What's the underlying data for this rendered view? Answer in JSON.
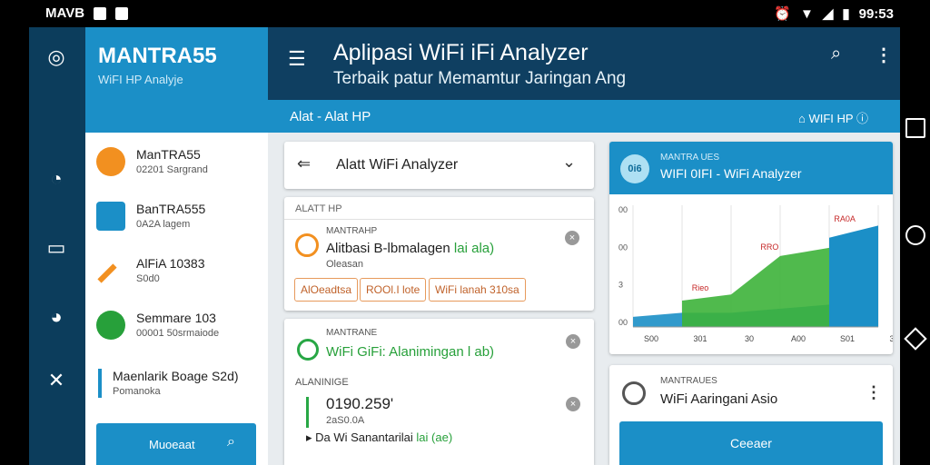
{
  "statusbar": {
    "left_text": "MAVB",
    "time": "99:53"
  },
  "drawer": {
    "title": "MANTRA55",
    "subtitle": "WiFI HP Analyje",
    "items": [
      {
        "t1": "ManTRA55",
        "t2": "02201 Sargrand",
        "color": "#f29020"
      },
      {
        "t1": "BanTRA555",
        "t2": "0A2A lagem",
        "color": "#1b8fc7"
      },
      {
        "t1": "AlFiA 10383",
        "t2": "S0d0",
        "color": "#f29020"
      },
      {
        "t1": "Semmare 103",
        "t2": "00001 50srmaiode",
        "color": "#27a03a"
      },
      {
        "t1": "Maenlarik Boage S2d)",
        "t2": "Pomanoka",
        "color": "#1b8fc7"
      }
    ],
    "button": "Muoeaat"
  },
  "appbar": {
    "title": "Aplipasi WiFi iFi Analyzer",
    "subtitle": "Terbaik patur Memamtur Jaringan Ang"
  },
  "subbar": {
    "left": "Alat - Alat HP",
    "right": "WIFI HP"
  },
  "select": {
    "label": "Alatt WiFi Analyzer"
  },
  "card1": {
    "header": "ALATT HP",
    "small": "MANTRAHP",
    "title_main": "Alitbasi B-lbmalagen",
    "title_green": "lai ala)",
    "sub": "Oleasan",
    "chips": [
      "AlOeadtsa",
      "ROOl.I lote",
      "WiFi lanah 310sa"
    ]
  },
  "card2": {
    "small": "MANTRANE",
    "title": "WiFi GiFi: Alanimingan l ab)",
    "header": "ALANINIGE",
    "value": "0190.259'",
    "sub": "2aS0.0A",
    "foot_main": "Da Wi Sanantarilai",
    "foot_green": "lai (ae)"
  },
  "chart_card": {
    "small": "MANTRA UES",
    "title": "WIFI 0IFI - WiFi Analyzer",
    "logo": "0i6"
  },
  "chart_data": {
    "type": "area",
    "categories": [
      "S00",
      "301",
      "30",
      "A00",
      "S01",
      "301"
    ],
    "y_tick_labels": [
      "00",
      "00",
      "3",
      "00"
    ],
    "annotations": [
      "Rieo",
      "RRO",
      "RA0A"
    ],
    "series": [
      {
        "color": "#1b8fc7",
        "values": [
          10,
          14,
          14,
          18,
          22,
          28
        ]
      },
      {
        "color": "#3db23a",
        "values": [
          0,
          26,
          32,
          70,
          78,
          0
        ]
      }
    ],
    "ylim": [
      0,
      120
    ]
  },
  "info_card": {
    "small": "MANTRAUES",
    "title": "WiFi Aaringani Asio",
    "button": "Ceeaer"
  }
}
